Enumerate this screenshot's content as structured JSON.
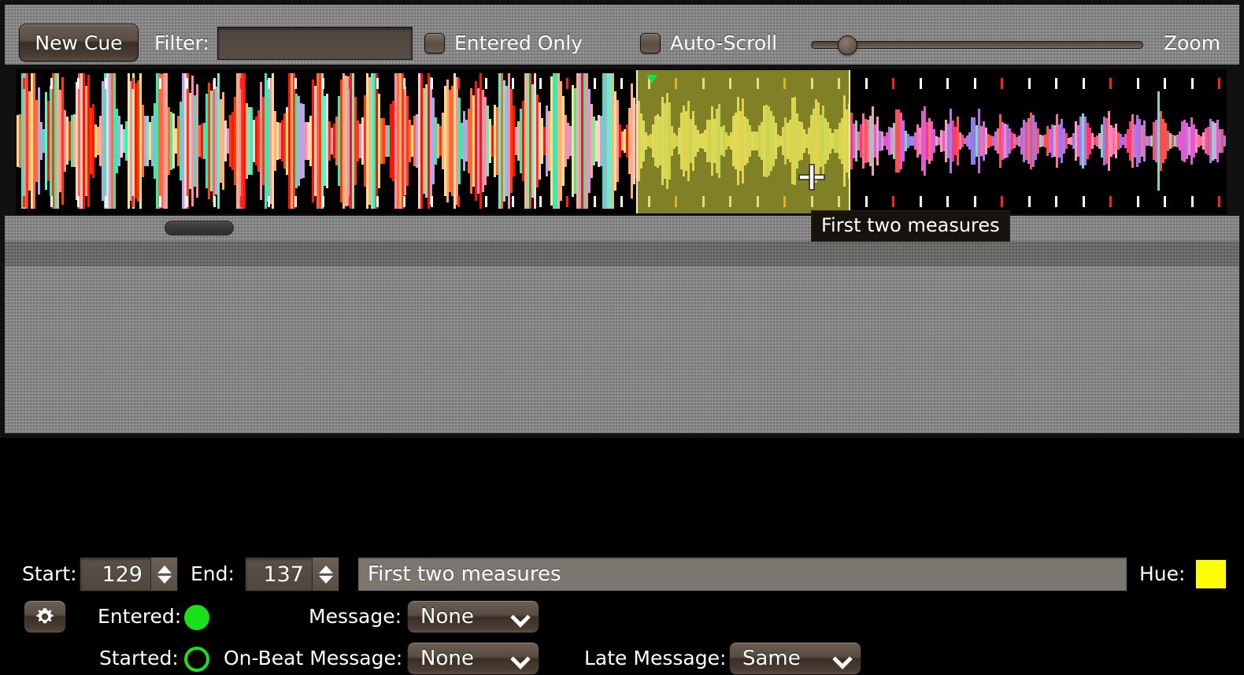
{
  "toolbar": {
    "new_cue_label": "New Cue",
    "filter_label": "Filter:",
    "filter_value": "",
    "filter_placeholder": "",
    "entered_only_label": "Entered Only",
    "entered_only_checked": false,
    "auto_scroll_label": "Auto-Scroll",
    "auto_scroll_checked": false,
    "zoom_label": "Zoom",
    "zoom_value": 8
  },
  "waveform": {
    "cue_tooltip": "First two measures",
    "cue_region_color": "#cece3e",
    "cue_marker_color": "#16e04a",
    "background_color": "#000000",
    "cursor": "crosshair"
  },
  "cue": {
    "start_label": "Start:",
    "start_value": "129",
    "end_label": "End:",
    "end_value": "137",
    "comment_value": "First two measures",
    "comment_placeholder": "",
    "hue_label": "Hue:",
    "hue_color": "#ffff00",
    "entered_label": "Entered:",
    "entered_state": "on",
    "started_label": "Started:",
    "started_state": "off",
    "message_label": "Message:",
    "message_value": "None",
    "onbeat_message_label": "On-Beat Message:",
    "onbeat_message_value": "None",
    "late_message_label": "Late Message:",
    "late_message_value": "Same",
    "gear_icon": "gear-icon"
  }
}
